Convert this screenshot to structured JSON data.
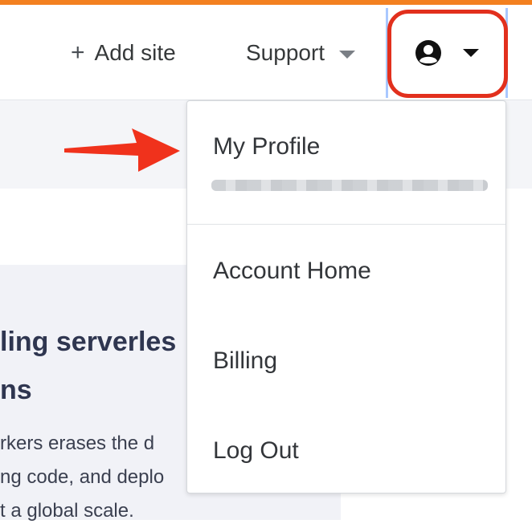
{
  "header": {
    "add_site_icon": "+",
    "add_site_label": "Add site",
    "support_label": "Support",
    "account_icon": "user-circle-icon"
  },
  "colors": {
    "accent": "#f38020",
    "annotation_red": "#e2301d"
  },
  "card": {
    "title": "ling serverles\nns",
    "body": "rkers erases the d\nng code, and deplo\nt a global scale."
  },
  "account_menu": {
    "items": [
      {
        "label": "My Profile"
      },
      {
        "label": "Account Home"
      },
      {
        "label": "Billing"
      },
      {
        "label": "Log Out"
      }
    ]
  }
}
